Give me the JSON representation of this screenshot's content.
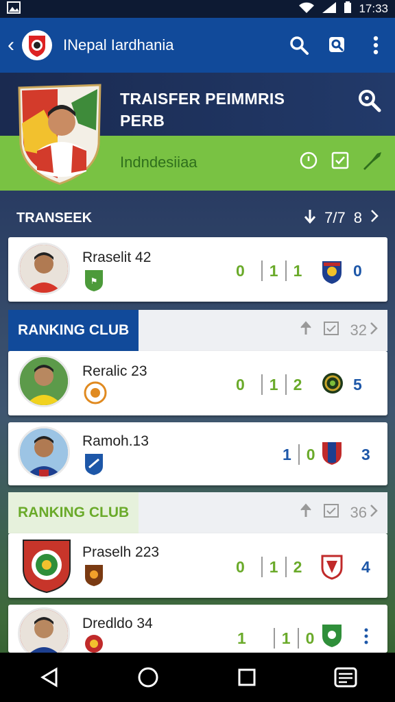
{
  "status": {
    "time": "17:33"
  },
  "appbar": {
    "title": "INepal Iardhania"
  },
  "hero": {
    "title_line1": "TRAISFER PEIMMRIS",
    "title_line2": "PERB",
    "country": "Indndesiiaa"
  },
  "transfers": {
    "label": "TRANSEEK",
    "num1": "7/7",
    "num2": "8"
  },
  "rows": [
    {
      "name": "Rraselit 42",
      "stat_a": "0",
      "stat_b": "1",
      "stat_c": "1",
      "end": "0"
    },
    {
      "name": "Reralic 23",
      "stat_a": "0",
      "stat_b": "1",
      "stat_c": "2",
      "end": "5"
    },
    {
      "name": "Ramoh.13",
      "stat_b": "1",
      "stat_c": "0",
      "end": "3"
    },
    {
      "name": "Praselh 223",
      "stat_a": "0",
      "stat_b": "1",
      "stat_c": "2",
      "end": "4"
    },
    {
      "name": "Dredldo 34",
      "stat_a": "1",
      "stat_b": "1",
      "stat_c": "0"
    }
  ],
  "ranking": [
    {
      "label": "RANKING CLUB",
      "count": "32"
    },
    {
      "label": "RANKING CLUB",
      "count": "36"
    }
  ],
  "colors": {
    "primary": "#114a9a",
    "accent_green": "#79c243",
    "stat_green": "#6aaa2a",
    "stat_blue": "#1d57a8"
  }
}
